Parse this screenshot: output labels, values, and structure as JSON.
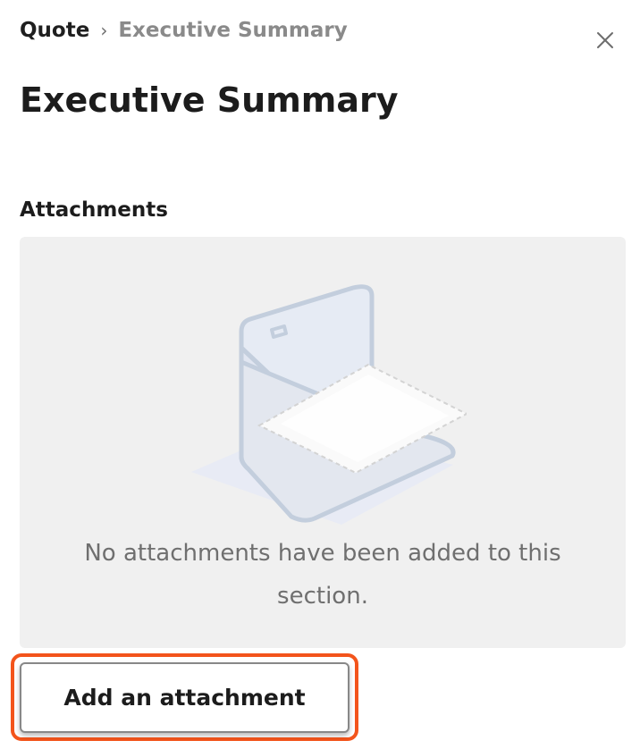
{
  "breadcrumb": {
    "root": "Quote",
    "separator": "›",
    "current": "Executive Summary"
  },
  "header": {
    "title": "Executive Summary",
    "close_icon": "close-icon"
  },
  "attachments": {
    "label": "Attachments",
    "empty_message": "No attachments have been added to this section.",
    "illustration": "folder-open-illustration",
    "add_button_label": "Add an attachment",
    "highlight_color": "#f3541b"
  }
}
